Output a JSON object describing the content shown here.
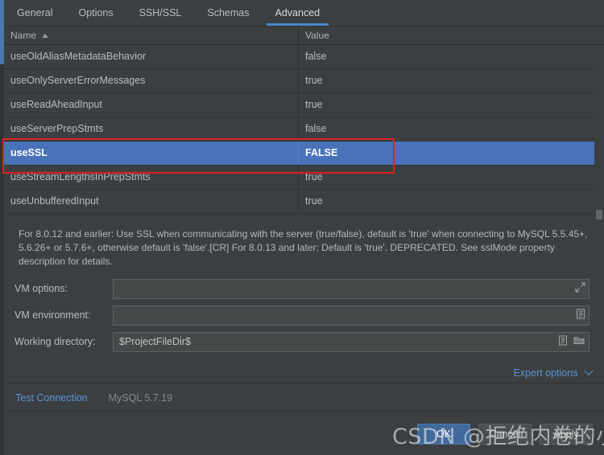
{
  "colors": {
    "background": "#3c3f41",
    "selection_blue": "#4a72b8",
    "accent_blue": "#4a88c7",
    "link_blue": "#5b93d6",
    "annotation_red": "#e02020"
  },
  "tabs": [
    {
      "label": "General",
      "active": false
    },
    {
      "label": "Options",
      "active": false
    },
    {
      "label": "SSH/SSL",
      "active": false
    },
    {
      "label": "Schemas",
      "active": false
    },
    {
      "label": "Advanced",
      "active": true
    }
  ],
  "table": {
    "columns": [
      {
        "label": "Name",
        "sorted": true,
        "sort_direction": "asc"
      },
      {
        "label": "Value",
        "sorted": false
      }
    ],
    "rows": [
      {
        "name": "useOldAliasMetadataBehavior",
        "value": "false",
        "selected": false
      },
      {
        "name": "useOnlyServerErrorMessages",
        "value": "true",
        "selected": false
      },
      {
        "name": "useReadAheadInput",
        "value": "true",
        "selected": false
      },
      {
        "name": "useServerPrepStmts",
        "value": "false",
        "selected": false
      },
      {
        "name": "useSSL",
        "value": "FALSE",
        "selected": true
      },
      {
        "name": "useStreamLengthsInPrepStmts",
        "value": "true",
        "selected": false
      },
      {
        "name": "useUnbufferedInput",
        "value": "true",
        "selected": false
      }
    ]
  },
  "description": "For 8.0.12 and earlier: Use SSL when communicating with the server (true/false), default is 'true' when connecting to MySQL 5.5.45+, 5.6.26+ or 5.7.6+, otherwise default is 'false'.[CR] For 8.0.13 and later: Default is 'true'. DEPRECATED. See sslMode property description for details.",
  "form": {
    "vm_options": {
      "label": "VM options:",
      "value": "",
      "placeholder": "",
      "icon": "expand-icon"
    },
    "vm_environment": {
      "label": "VM environment:",
      "value": "",
      "placeholder": "",
      "icon": "list-icon"
    },
    "working_directory": {
      "label": "Working directory:",
      "value": "$ProjectFileDir$",
      "placeholder": "",
      "icons": [
        "list-icon",
        "folder-icon"
      ]
    }
  },
  "expert_options": {
    "label": "Expert options",
    "icon": "chevron-down-icon"
  },
  "footer": {
    "test_connection": "Test Connection",
    "driver_version": "MySQL 5.7.19"
  },
  "dialog_buttons": [
    {
      "label": "OK",
      "primary": true
    },
    {
      "label": "Cancel",
      "primary": false
    },
    {
      "label": "Apply",
      "primary": false
    }
  ],
  "watermark": "CSDN @拒绝内卷的小测试"
}
